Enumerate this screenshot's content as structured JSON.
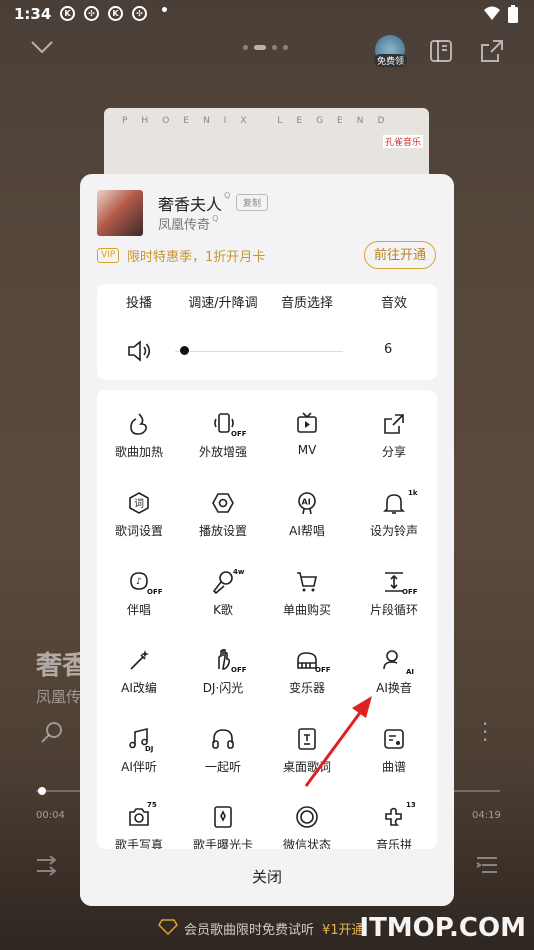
{
  "status": {
    "time": "1:34"
  },
  "player_bg": {
    "cover_text": "PHOENIX LEGEND",
    "cover_badge": "孔雀音乐",
    "title": "奢香",
    "artist": "凤凰传",
    "time_current": "00:04",
    "time_total": "04:19",
    "avatar_badge": "免费领"
  },
  "song": {
    "title": "奢香夫人",
    "artist": "凤凰传奇",
    "copy_label": "复制"
  },
  "vip": {
    "badge": "VIP",
    "text": "限时特惠季，1折开月卡",
    "button": "前往开通"
  },
  "top_row": [
    "投播",
    "调速/升降调",
    "音质选择",
    "音效"
  ],
  "volume": {
    "value": "6",
    "level": 0.05
  },
  "grid": [
    {
      "label": "歌曲加热",
      "icon": "flame-icon"
    },
    {
      "label": "外放增强",
      "icon": "phone-speaker-icon",
      "tag": "OFF"
    },
    {
      "label": "MV",
      "icon": "tv-icon"
    },
    {
      "label": "分享",
      "icon": "share-icon"
    },
    {
      "label": "歌词设置",
      "icon": "lyrics-icon"
    },
    {
      "label": "播放设置",
      "icon": "hexagon-icon"
    },
    {
      "label": "AI帮唱",
      "icon": "ai-mic-icon"
    },
    {
      "label": "设为铃声",
      "icon": "bell-icon",
      "tag": "1k"
    },
    {
      "label": "伴唱",
      "icon": "accompany-icon",
      "tag": "OFF"
    },
    {
      "label": "K歌",
      "icon": "karaoke-mic-icon",
      "tag": "4w"
    },
    {
      "label": "单曲购买",
      "icon": "cart-icon"
    },
    {
      "label": "片段循环",
      "icon": "segment-loop-icon",
      "tag": "OFF"
    },
    {
      "label": "AI改编",
      "icon": "magic-wand-icon"
    },
    {
      "label": "DJ·闪光",
      "icon": "dj-hand-icon",
      "tag": "OFF"
    },
    {
      "label": "变乐器",
      "icon": "piano-icon",
      "tag": "OFF"
    },
    {
      "label": "AI换音",
      "icon": "ai-voice-icon",
      "tag": "AI"
    },
    {
      "label": "AI伴听",
      "icon": "music-note-icon",
      "tag": "DJ"
    },
    {
      "label": "一起听",
      "icon": "headphones-icon"
    },
    {
      "label": "桌面歌词",
      "icon": "desktop-lyrics-icon"
    },
    {
      "label": "曲谱",
      "icon": "score-icon"
    },
    {
      "label": "歌手写真",
      "icon": "photo-icon",
      "tag": "75"
    },
    {
      "label": "歌手曝光卡",
      "icon": "card-icon"
    },
    {
      "label": "微信状态",
      "icon": "wechat-status-icon"
    },
    {
      "label": "音乐拼",
      "icon": "puzzle-icon",
      "tag": "13"
    }
  ],
  "close_label": "关闭",
  "promo": {
    "text": "会员歌曲限时免费试听",
    "cta": "¥1开通"
  },
  "watermark": "ITMOP.COM",
  "colors": {
    "accent_gold": "#d8a330",
    "arrow_red": "#e02020"
  }
}
